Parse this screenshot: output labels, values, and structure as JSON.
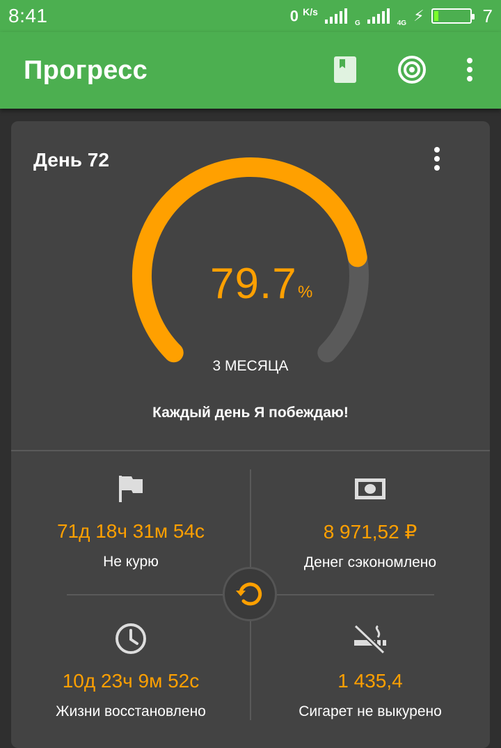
{
  "status_bar": {
    "time": "8:41",
    "net_speed": "0",
    "net_unit": "K/s",
    "sim1_tag": "G",
    "sim2_tag": "4G",
    "battery_level": "7"
  },
  "app_bar": {
    "title": "Прогресс",
    "icons": [
      "book-icon",
      "target-icon",
      "more-vert-icon"
    ]
  },
  "progress_card": {
    "day_label": "День 72",
    "percent_value": "79.7",
    "percent_sign": "%",
    "progress_fraction": 0.797,
    "period_label": "3 МЕСЯЦА",
    "motto": "Каждый день Я побеждаю!"
  },
  "stats": {
    "not_smoking": {
      "value": "71д 18ч 31м 54с",
      "label": "Не курю",
      "icon": "flag-icon"
    },
    "money_saved": {
      "value": "8 971,52 ₽",
      "label": "Денег сэкономлено",
      "icon": "money-icon"
    },
    "life_restored": {
      "value": "10д 23ч 9м 52с",
      "label": "Жизни восстановлено",
      "icon": "clock-icon"
    },
    "cigs_not_smoked": {
      "value": "1 435,4",
      "label": "Сигарет не выкурено",
      "icon": "no-smoking-icon"
    }
  },
  "colors": {
    "primary": "#4caf50",
    "accent": "#ffa000",
    "card": "#434343",
    "background": "#2f2f2f",
    "track": "#5a5a5a"
  }
}
